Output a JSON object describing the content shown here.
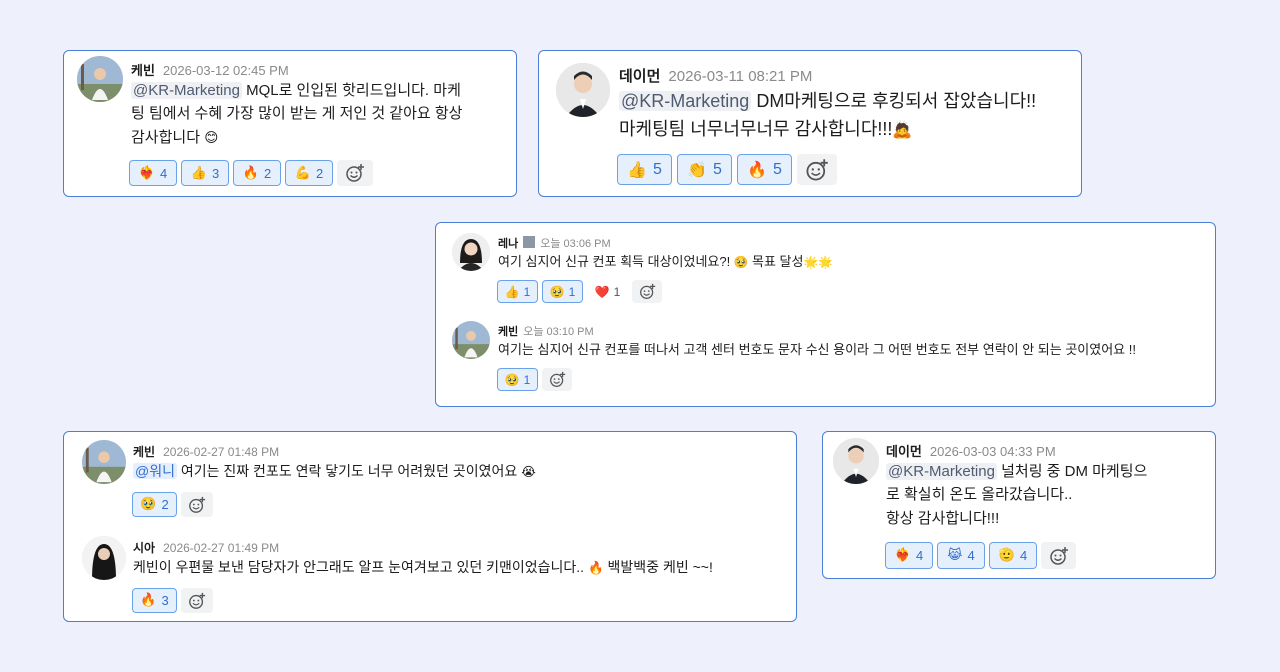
{
  "colors": {
    "background": "#eef1fb",
    "card_border": "#4a7fd6",
    "reaction_bg": "#e6f0fd",
    "reaction_border": "#6aa2ea",
    "reaction_text": "#2f6fd1",
    "mention_bg": "#eef0f4"
  },
  "cards": [
    {
      "messages": [
        {
          "author": "케빈",
          "time": "2026-03-12 02:45 PM",
          "mention": "@KR-Marketing",
          "text_line1": " MQL로 인입된 핫리드입니다. 마케",
          "text_line2": "팅 팀에서 수혜 가장 많이 받는 게 저인 것 같아요 항상",
          "text_line3": "감사합니다",
          "trailing_emoji": "😊",
          "reactions": [
            {
              "emoji": "❤️‍🔥",
              "icon": "heart-on-fire-icon",
              "count": "4"
            },
            {
              "emoji": "👍",
              "icon": "thumbs-up-icon",
              "count": "3"
            },
            {
              "emoji": "🔥",
              "icon": "fire-icon",
              "count": "2"
            },
            {
              "emoji": "💪",
              "icon": "flexed-biceps-icon",
              "count": "2"
            }
          ]
        }
      ]
    },
    {
      "messages": [
        {
          "author": "데이먼",
          "time": "2026-03-11 08:21 PM",
          "mention": "@KR-Marketing",
          "text_line1": " DM마케팅으로 후킹되서 잡았습니다!!",
          "text_line2": "마케팅팀 너무너무너무 감사합니다!!!",
          "trailing_emoji": "🙇",
          "reactions": [
            {
              "emoji": "👍",
              "icon": "thumbs-up-icon",
              "count": "5"
            },
            {
              "emoji": "👏",
              "icon": "clapping-hands-icon",
              "count": "5"
            },
            {
              "emoji": "🔥",
              "icon": "fire-icon",
              "count": "5"
            }
          ]
        }
      ]
    },
    {
      "messages": [
        {
          "author": "레나",
          "status_icon": "building-icon",
          "time": "오늘 03:06 PM",
          "text_line1": "여기 심지어 신규 컨포 획득 대상이었네요?! ",
          "mid_emoji": "🥹",
          "text_after": " 목표 달성",
          "trailing_emoji": "🌟🌟",
          "reactions": [
            {
              "emoji": "👍",
              "icon": "thumbs-up-icon",
              "count": "1"
            },
            {
              "emoji": "🥹",
              "icon": "teary-face-icon",
              "count": "1"
            },
            {
              "emoji": "❤️",
              "icon": "red-heart-icon",
              "count": "1"
            }
          ]
        },
        {
          "author": "케빈",
          "time": "오늘 03:10 PM",
          "text_line1": "여기는 심지어 신규 컨포를 떠나서 고객 센터 번호도 문자 수신 용이라 그 어떤 번호도 전부 연락이 안 되는 곳이였어요 !!",
          "reactions": [
            {
              "emoji": "🥹",
              "icon": "teary-face-icon",
              "count": "1"
            }
          ]
        }
      ]
    },
    {
      "messages": [
        {
          "author": "케빈",
          "time": "2026-02-27 01:48 PM",
          "mention": "@워니",
          "text_line1": " 여기는 진짜 컨포도 연락 닿기도 너무 어려웠던 곳이였어요 ",
          "trailing_emoji": "😭",
          "reactions": [
            {
              "emoji": "🥹",
              "icon": "teary-face-icon",
              "count": "2"
            }
          ]
        },
        {
          "author": "시아",
          "time": "2026-02-27 01:49 PM",
          "text_line1": "케빈이 우편물 보낸 담당자가 안그래도 알프 눈여겨보고 있던 키맨이었습니다.. ",
          "mid_emoji": "🔥",
          "text_after": " 백발백중 케빈 ~~!",
          "reactions": [
            {
              "emoji": "🔥",
              "icon": "fire-icon",
              "count": "3"
            }
          ]
        }
      ]
    },
    {
      "messages": [
        {
          "author": "데이먼",
          "time": "2026-03-03 04:33 PM",
          "mention": "@KR-Marketing",
          "text_line1": " 널처링 중 DM 마케팅으",
          "text_line2": "로 확실히 온도 올라갔습니다..",
          "text_line3": "항상 감사합니다!!!",
          "reactions": [
            {
              "emoji": "❤️‍🔥",
              "icon": "heart-on-fire-icon",
              "count": "4"
            },
            {
              "emoji": "😹",
              "icon": "laughing-face-icon",
              "count": "4"
            },
            {
              "emoji": "🫡",
              "icon": "saluting-hand-icon",
              "count": "4"
            }
          ]
        }
      ]
    }
  ]
}
